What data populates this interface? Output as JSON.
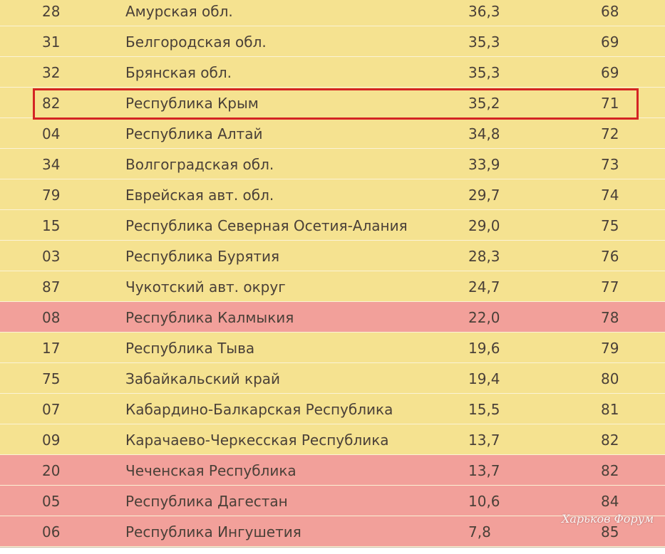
{
  "table": {
    "rows": [
      {
        "code": "28",
        "name": "Амурская обл.",
        "value": "36,3",
        "rank": "68",
        "color": "yellow"
      },
      {
        "code": "31",
        "name": "Белгородская обл.",
        "value": "35,3",
        "rank": "69",
        "color": "yellow"
      },
      {
        "code": "32",
        "name": "Брянская обл.",
        "value": "35,3",
        "rank": "69",
        "color": "yellow"
      },
      {
        "code": "82",
        "name": "Республика Крым",
        "value": "35,2",
        "rank": "71",
        "color": "yellow",
        "highlighted": true
      },
      {
        "code": "04",
        "name": "Республика Алтай",
        "value": "34,8",
        "rank": "72",
        "color": "yellow"
      },
      {
        "code": "34",
        "name": "Волгоградская обл.",
        "value": "33,9",
        "rank": "73",
        "color": "yellow"
      },
      {
        "code": "79",
        "name": "Еврейская авт. обл.",
        "value": "29,7",
        "rank": "74",
        "color": "yellow"
      },
      {
        "code": "15",
        "name": "Республика Северная Осетия-Алания",
        "value": "29,0",
        "rank": "75",
        "color": "yellow"
      },
      {
        "code": "03",
        "name": "Республика Бурятия",
        "value": "28,3",
        "rank": "76",
        "color": "yellow"
      },
      {
        "code": "87",
        "name": "Чукотский авт. округ",
        "value": "24,7",
        "rank": "77",
        "color": "yellow"
      },
      {
        "code": "08",
        "name": "Республика Калмыкия",
        "value": "22,0",
        "rank": "78",
        "color": "pink"
      },
      {
        "code": "17",
        "name": "Республика Тыва",
        "value": "19,6",
        "rank": "79",
        "color": "yellow"
      },
      {
        "code": "75",
        "name": "Забайкальский край",
        "value": "19,4",
        "rank": "80",
        "color": "yellow"
      },
      {
        "code": "07",
        "name": "Кабардино-Балкарская Республика",
        "value": "15,5",
        "rank": "81",
        "color": "yellow"
      },
      {
        "code": "09",
        "name": "Карачаево-Черкесская Республика",
        "value": "13,7",
        "rank": "82",
        "color": "yellow"
      },
      {
        "code": "20",
        "name": "Чеченская Республика",
        "value": "13,7",
        "rank": "82",
        "color": "pink"
      },
      {
        "code": "05",
        "name": "Республика Дагестан",
        "value": "10,6",
        "rank": "84",
        "color": "pink"
      },
      {
        "code": "06",
        "name": "Республика Ингушетия",
        "value": "7,8",
        "rank": "85",
        "color": "pink"
      }
    ]
  },
  "watermark": "Харьков Форум",
  "colors": {
    "yellow_row": "#f5e290",
    "pink_row": "#f2a09a",
    "highlight_border": "#d42424",
    "text": "#4a4038"
  }
}
